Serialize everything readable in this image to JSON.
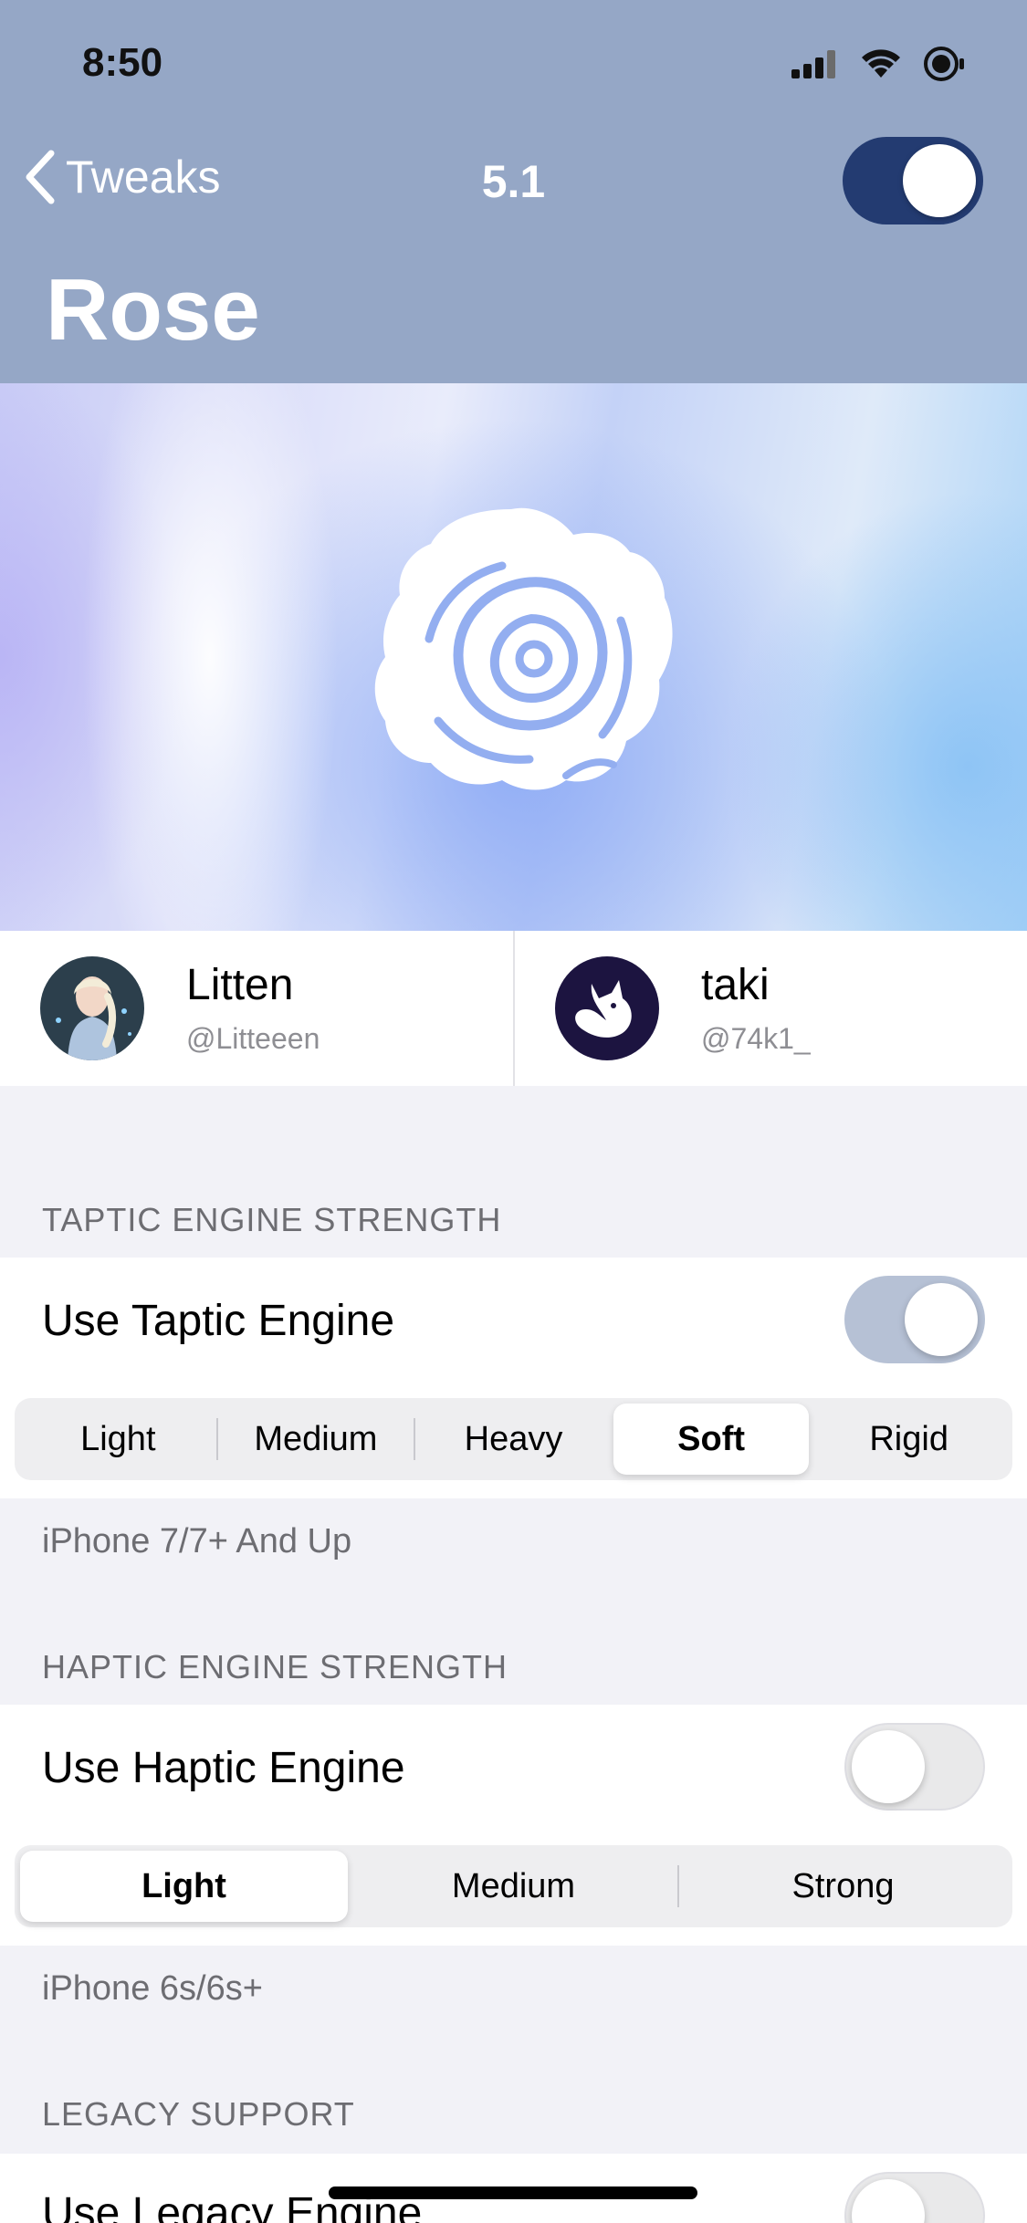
{
  "status_bar": {
    "time": "8:50",
    "icons": [
      "signal-icon",
      "wifi-icon",
      "focus-icon"
    ]
  },
  "nav": {
    "back_label": "Tweaks",
    "title": "5.1",
    "enabled": true
  },
  "page_title": "Rose",
  "authors": [
    {
      "name": "Litten",
      "handle": "@Litteeen"
    },
    {
      "name": "taki",
      "handle": "@74k1_"
    }
  ],
  "taptic": {
    "header": "TAPTIC ENGINE STRENGTH",
    "toggle_label": "Use Taptic Engine",
    "enabled": true,
    "segments": [
      "Light",
      "Medium",
      "Heavy",
      "Soft",
      "Rigid"
    ],
    "selected": "Soft",
    "footer": "iPhone 7/7+ And Up"
  },
  "haptic": {
    "header": "HAPTIC ENGINE STRENGTH",
    "toggle_label": "Use Haptic Engine",
    "enabled": false,
    "segments": [
      "Light",
      "Medium",
      "Strong"
    ],
    "selected": "Light",
    "footer": "iPhone 6s/6s+"
  },
  "legacy": {
    "header": "LEGACY SUPPORT",
    "toggle_label": "Use Legacy Engine",
    "enabled": false
  },
  "colors": {
    "header_bg": "#95a7c6",
    "toggle_on_dark": "#233b71",
    "toggle_on_light": "#b6c1d5"
  }
}
